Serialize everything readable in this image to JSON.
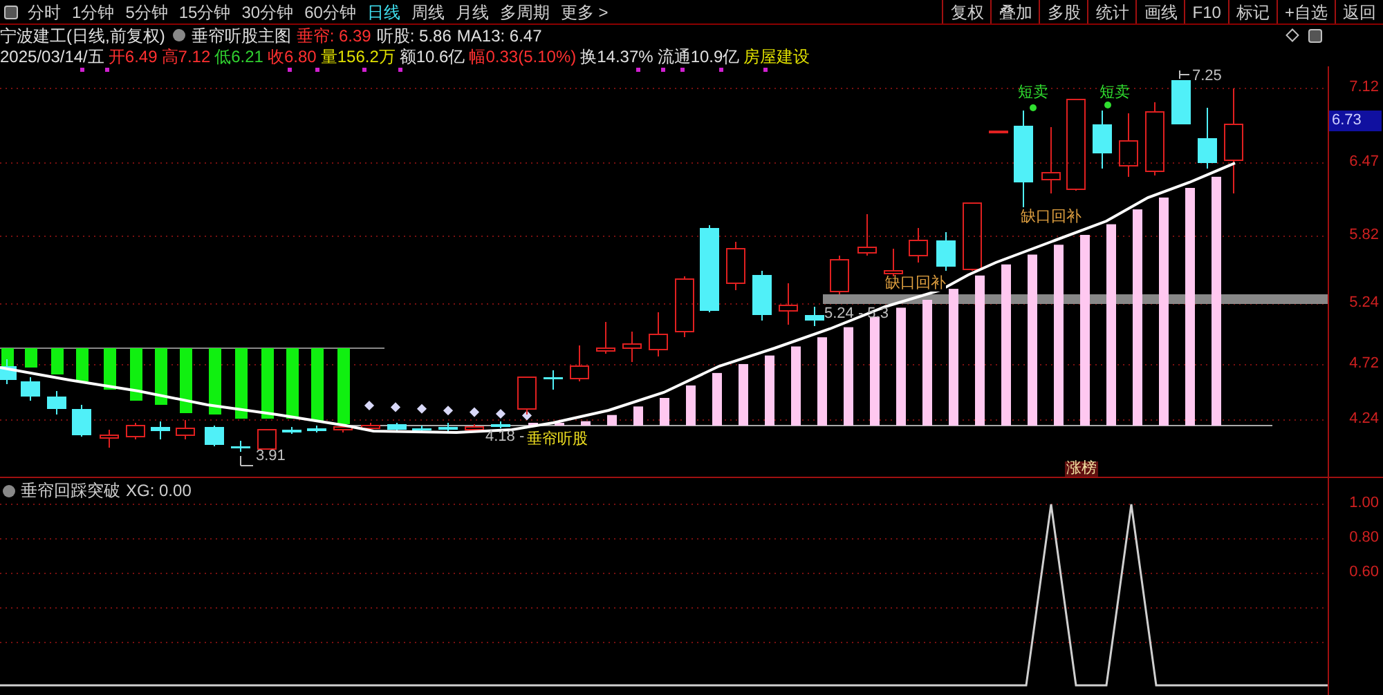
{
  "toolbar": {
    "periods": [
      {
        "label": "分时",
        "selected": false
      },
      {
        "label": "1分钟",
        "selected": false
      },
      {
        "label": "5分钟",
        "selected": false
      },
      {
        "label": "15分钟",
        "selected": false
      },
      {
        "label": "30分钟",
        "selected": false
      },
      {
        "label": "60分钟",
        "selected": false
      },
      {
        "label": "日线",
        "selected": true
      },
      {
        "label": "周线",
        "selected": false
      },
      {
        "label": "月线",
        "selected": false
      },
      {
        "label": "多周期",
        "selected": false
      },
      {
        "label": "更多 >",
        "selected": false
      }
    ],
    "buttons": [
      "复权",
      "叠加",
      "多股",
      "统计",
      "画线",
      "F10",
      "标记",
      "+自选",
      "返回"
    ]
  },
  "info": {
    "stock": "宁波建工(日线,前复权)",
    "indicator": "垂帘听股主图",
    "fields": [
      {
        "text": "垂帘: 6.39",
        "color": "#ff3030"
      },
      {
        "text": "听股: 5.86",
        "color": "#e0e0e0"
      },
      {
        "text": "MA13: 6.47",
        "color": "#e0e0e0"
      }
    ],
    "quote": [
      {
        "text": "2025/03/14/五",
        "color": "#e0e0e0"
      },
      {
        "text": "开6.49",
        "color": "#ff3030"
      },
      {
        "text": "高7.12",
        "color": "#ff3030"
      },
      {
        "text": "低6.21",
        "color": "#30d030"
      },
      {
        "text": "收6.80",
        "color": "#ff3030"
      },
      {
        "text": "量156.2万",
        "color": "#e0e000"
      },
      {
        "text": "额10.6亿",
        "color": "#e0e0e0"
      },
      {
        "text": "幅0.33(5.10%)",
        "color": "#ff3030"
      },
      {
        "text": "换14.37%",
        "color": "#e0e0e0"
      },
      {
        "text": "流通10.9亿",
        "color": "#e0e0e0"
      },
      {
        "text": "房屋建设",
        "color": "#e0e000"
      }
    ]
  },
  "main_chart": {
    "y_axis": [
      {
        "label": "7.12",
        "highlighted": false
      },
      {
        "label": "6.73",
        "highlighted": true
      },
      {
        "label": "6.47",
        "highlighted": false
      },
      {
        "label": "5.82",
        "highlighted": false
      },
      {
        "label": "5.24",
        "highlighted": false
      },
      {
        "label": "4.72",
        "highlighted": false
      },
      {
        "label": "4.24",
        "highlighted": false
      }
    ],
    "annotations": [
      {
        "text": "短卖",
        "kind": "signal"
      },
      {
        "text": "短卖",
        "kind": "signal"
      },
      {
        "text": "7.25",
        "kind": "price"
      },
      {
        "text": "缺口回补",
        "kind": "gap"
      },
      {
        "text": "缺口回补",
        "kind": "gap"
      },
      {
        "text": "5.24 - 5.3",
        "kind": "price"
      },
      {
        "text": "3.91",
        "kind": "price"
      },
      {
        "text": "4.18 -",
        "kind": "price"
      },
      {
        "text": "垂帘听股",
        "kind": "label"
      }
    ],
    "tag": "涨榜"
  },
  "lower_panel": {
    "title": "垂帘回踩突破",
    "reading": "XG: 0.00",
    "y_axis": [
      "1.00",
      "0.80",
      "0.60"
    ]
  }
}
